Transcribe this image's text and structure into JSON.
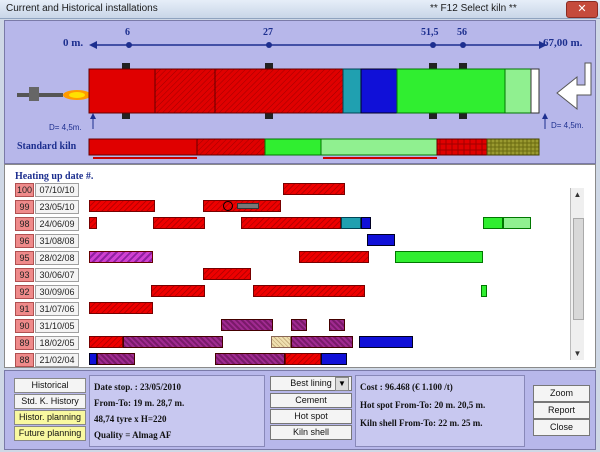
{
  "window": {
    "title": "Current and Historical installations",
    "hint": "** F12 Select kiln **",
    "close": "✕"
  },
  "kiln": {
    "start_label": "0 m.",
    "end_label": "67,00 m.",
    "markers": [
      "6",
      "27",
      "51,5",
      "56"
    ],
    "d_left": "D= 4,5m.",
    "d_right": "D= 4,5m.",
    "standard_label": "Standard kiln"
  },
  "list": {
    "header": "Heating up date #.",
    "rows": [
      {
        "num": "100",
        "date": "07/10/10"
      },
      {
        "num": "99",
        "date": "23/05/10"
      },
      {
        "num": "98",
        "date": "24/06/09"
      },
      {
        "num": "96",
        "date": "31/08/08"
      },
      {
        "num": "95",
        "date": "28/02/08"
      },
      {
        "num": "93",
        "date": "30/06/07"
      },
      {
        "num": "92",
        "date": "30/09/06"
      },
      {
        "num": "91",
        "date": "31/07/06"
      },
      {
        "num": "90",
        "date": "31/10/05"
      },
      {
        "num": "89",
        "date": "18/02/05"
      },
      {
        "num": "88",
        "date": "21/02/04"
      }
    ],
    "scroll_up": "▲",
    "scroll_down": "▼"
  },
  "nav": {
    "historical": "Historical",
    "std_history": "Std. K. History",
    "histor_planning": "Histor. planning",
    "future_planning": "Future planning"
  },
  "details": {
    "date_stop": "Date stop. : 23/05/2010",
    "from_to": "From-To: 19 m. 28,7 m.",
    "tyre": "48,74 tyre x H=220",
    "quality": "Quality = Almag AF"
  },
  "materials": {
    "lining": "Best lining",
    "cement": "Cement",
    "hotspot": "Hot spot",
    "kilnshell": "Kiln shell"
  },
  "cost": {
    "cost": "Cost : 96.468 (€ 1.100 /t)",
    "hotspot": "Hot spot From-To: 20 m. 20,5 m.",
    "kilnshell": "Kiln shell From-To: 22 m. 25 m."
  },
  "actions": {
    "zoom": "Zoom",
    "report": "Report",
    "close": "Close"
  },
  "colors": {
    "panel": "#b7b7ea",
    "lining_red": "#e00000",
    "green": "#30ee30",
    "blue": "#1010d8"
  }
}
